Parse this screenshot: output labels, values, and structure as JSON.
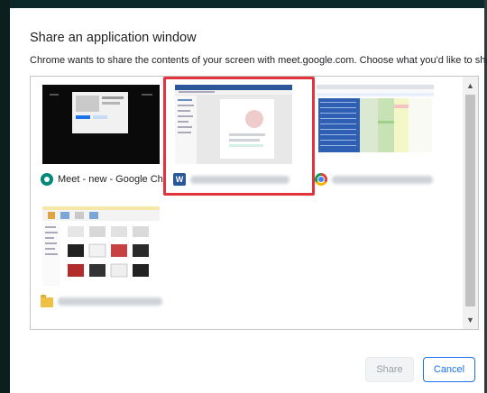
{
  "dialog": {
    "title": "Share an application window",
    "subtitle": "Chrome wants to share the contents of your screen with meet.google.com. Choose what you'd like to share."
  },
  "windows": [
    {
      "label": "Meet - new - Google Ch...",
      "icon": "meet-icon",
      "selected": false
    },
    {
      "label": "",
      "icon": "word-icon",
      "selected": true
    },
    {
      "label": "",
      "icon": "chrome-icon",
      "selected": false
    },
    {
      "label": "",
      "icon": "folder-icon",
      "selected": false
    }
  ],
  "icons": {
    "word_letter": "W",
    "scroll_up": "▲",
    "scroll_down": "▼"
  },
  "buttons": {
    "share_label": "Share",
    "cancel_label": "Cancel"
  },
  "colors": {
    "selection_border": "#e3343d",
    "cancel_accent": "#1a73e8",
    "share_disabled_text": "#9aa0a6"
  }
}
